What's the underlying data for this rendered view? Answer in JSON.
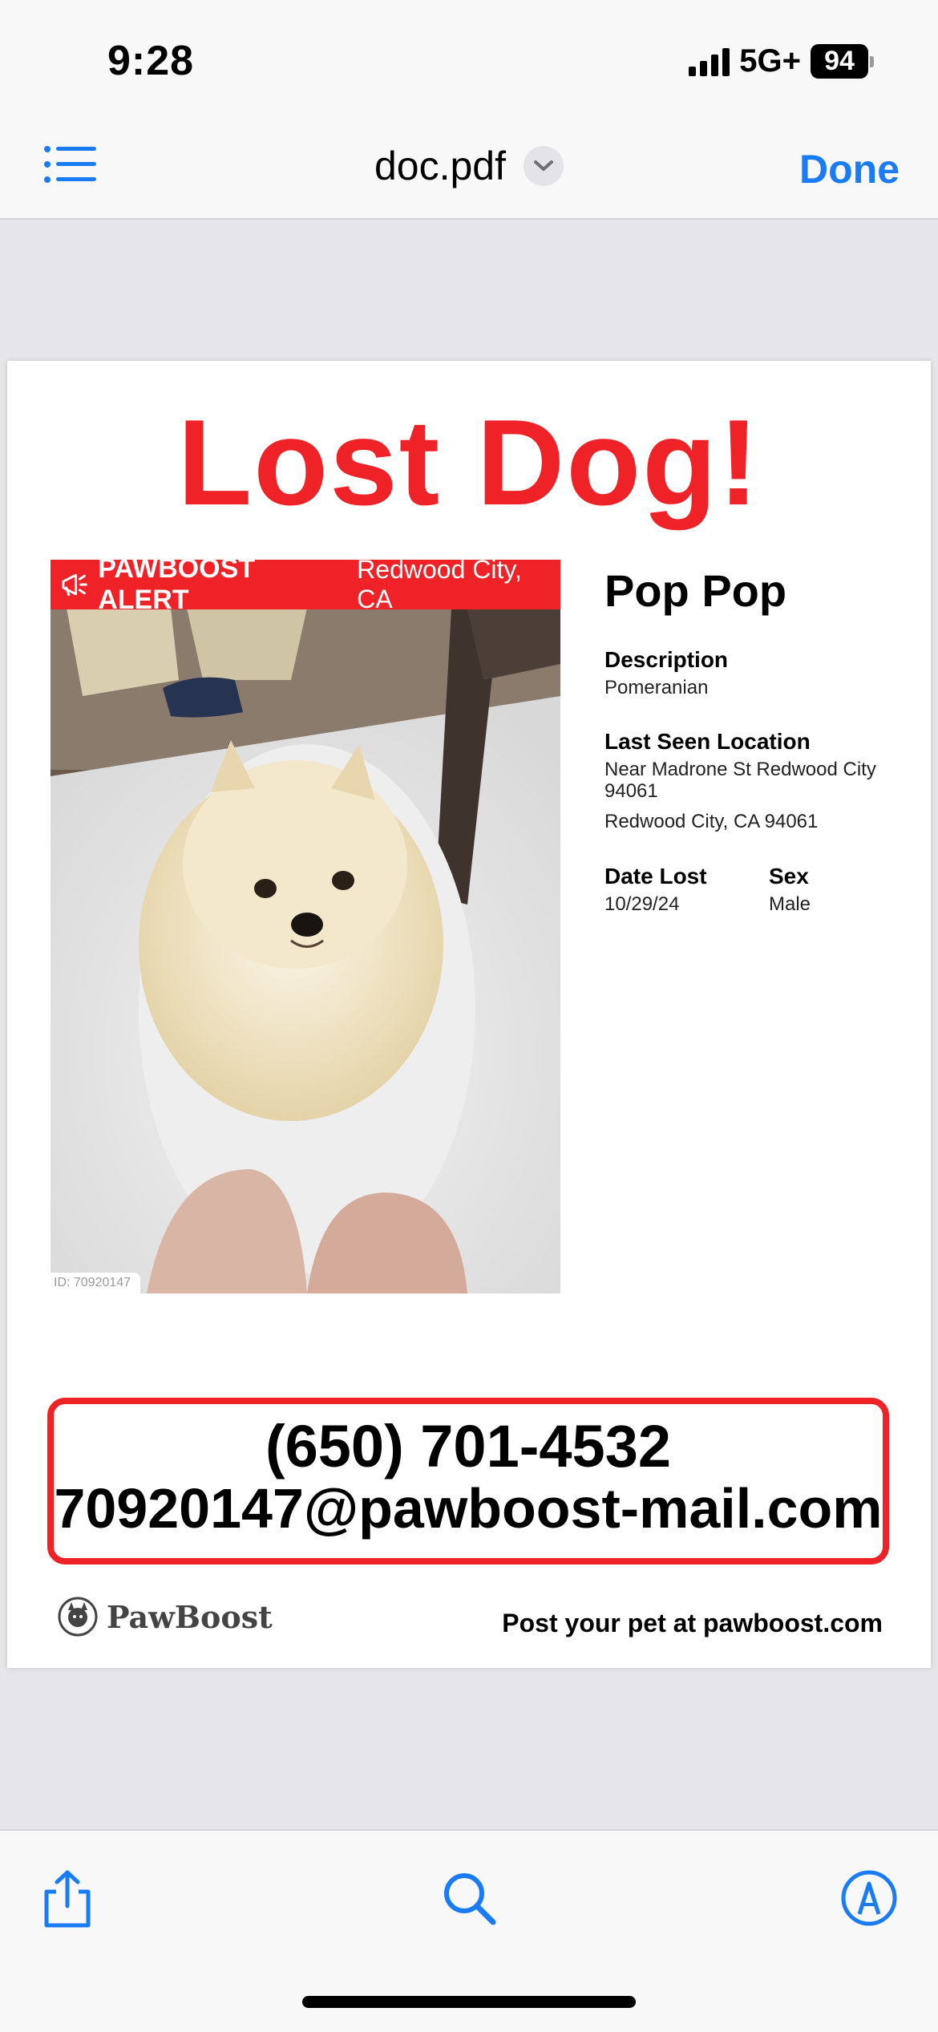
{
  "status_bar": {
    "time": "9:28",
    "network": "5G+",
    "battery": "94"
  },
  "nav": {
    "title": "doc.pdf",
    "done_label": "Done",
    "list_icon": "list-icon",
    "chevron_icon": "chevron-down-icon"
  },
  "flyer": {
    "headline": "Lost Dog!",
    "alert": {
      "label": "PAWBOOST ALERT",
      "location": "Redwood City, CA"
    },
    "photo_id": "ID: 70920147",
    "pet_name": "Pop Pop",
    "description_label": "Description",
    "description": "Pomeranian",
    "last_seen_label": "Last Seen Location",
    "last_seen_line1": "Near Madrone St Redwood City 94061",
    "last_seen_line2": "Redwood City, CA 94061",
    "date_lost_label": "Date Lost",
    "date_lost": "10/29/24",
    "sex_label": "Sex",
    "sex": "Male",
    "phone": "(650) 701-4532",
    "email": "70920147@pawboost-mail.com",
    "brand": "PawBoost",
    "post_line": "Post your pet at pawboost.com"
  },
  "toolbar": {
    "share_icon": "share-icon",
    "search_icon": "search-icon",
    "markup_icon": "markup-icon"
  },
  "colors": {
    "accent": "#1a7cf5",
    "alert_red": "#ee2227"
  }
}
